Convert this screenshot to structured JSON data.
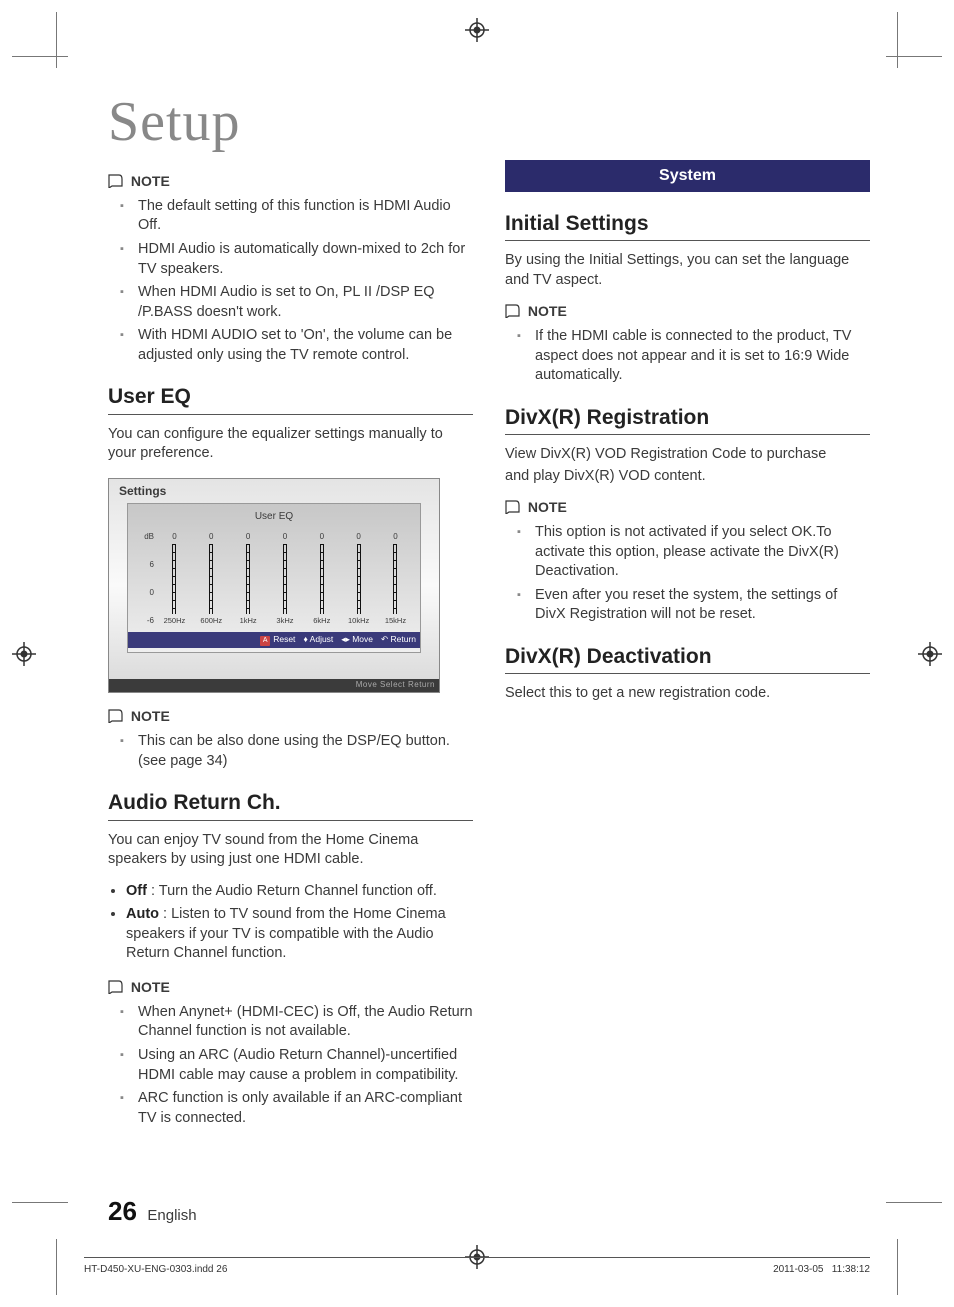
{
  "page": {
    "title": "Setup",
    "number": "26",
    "language": "English"
  },
  "print": {
    "file": "HT-D450-XU-ENG-0303.indd   26",
    "timestamp": "2011-03-05     11:38:12"
  },
  "left": {
    "note1": {
      "label": "NOTE",
      "items": [
        "The default setting of this function is HDMI Audio Off.",
        "HDMI Audio is automatically down-mixed to 2ch for TV speakers.",
        "When HDMI Audio is set to On, PL II /DSP EQ /P.BASS doesn't work.",
        "With HDMI AUDIO set to 'On', the volume can be adjusted only using the TV remote control."
      ]
    },
    "userEQ": {
      "heading": "User EQ",
      "body": "You can configure the equalizer settings manually to your preference.",
      "figure": {
        "topLabel": "Settings",
        "title": "User EQ",
        "dbLabel": "dB",
        "yTicks": [
          "6",
          "0",
          "-6"
        ],
        "sliders": [
          {
            "val": "0",
            "freq": "250Hz"
          },
          {
            "val": "0",
            "freq": "600Hz"
          },
          {
            "val": "0",
            "freq": "1kHz"
          },
          {
            "val": "0",
            "freq": "3kHz"
          },
          {
            "val": "0",
            "freq": "6kHz"
          },
          {
            "val": "0",
            "freq": "10kHz"
          },
          {
            "val": "0",
            "freq": "15kHz"
          }
        ],
        "controls": {
          "reset": "Reset",
          "adjust": "Adjust",
          "move": "Move",
          "return": "Return"
        },
        "shadow": "Move      Select      Return"
      },
      "note": {
        "label": "NOTE",
        "items": [
          "This can be also done using the DSP/EQ button. (see page 34)"
        ]
      }
    },
    "arc": {
      "heading": "Audio Return Ch.",
      "body": "You can enjoy TV sound from the Home Cinema speakers by using just one HDMI cable.",
      "bullets": [
        {
          "term": "Off",
          "text": " : Turn the Audio Return Channel function off."
        },
        {
          "term": "Auto",
          "text": " : Listen to TV sound from the Home Cinema speakers if your TV is compatible with the Audio Return Channel function."
        }
      ],
      "note": {
        "label": "NOTE",
        "items": [
          "When Anynet+ (HDMI-CEC) is Off, the Audio Return Channel function is not available.",
          "Using an ARC (Audio Return Channel)-uncertified HDMI cable may cause a problem in compatibility.",
          "ARC function is only available if an ARC-compliant TV is connected."
        ]
      }
    }
  },
  "right": {
    "banner": "System",
    "initial": {
      "heading": "Initial Settings",
      "body": "By using the Initial Settings, you can set the language and TV aspect.",
      "note": {
        "label": "NOTE",
        "items": [
          "If the HDMI cable is connected to the product, TV aspect does not appear and it is set to 16:9 Wide automatically."
        ]
      }
    },
    "divxReg": {
      "heading": "DivX(R) Registration",
      "body1": "View DivX(R) VOD Registration Code to purchase",
      "body2": "and play DivX(R) VOD content.",
      "note": {
        "label": "NOTE",
        "items": [
          "This option is not activated if you select OK.To activate this option, please activate the DivX(R) Deactivation.",
          "Even after you reset the system, the settings of DivX Registration will not be reset."
        ]
      }
    },
    "divxDeact": {
      "heading": "DivX(R) Deactivation",
      "body": "Select this to get a new registration code."
    }
  },
  "chart_data": {
    "type": "bar",
    "title": "User EQ",
    "xlabel": "",
    "ylabel": "dB",
    "categories": [
      "250Hz",
      "600Hz",
      "1kHz",
      "3kHz",
      "6kHz",
      "10kHz",
      "15kHz"
    ],
    "values": [
      0,
      0,
      0,
      0,
      0,
      0,
      0
    ],
    "ylim": [
      -6,
      6
    ]
  }
}
